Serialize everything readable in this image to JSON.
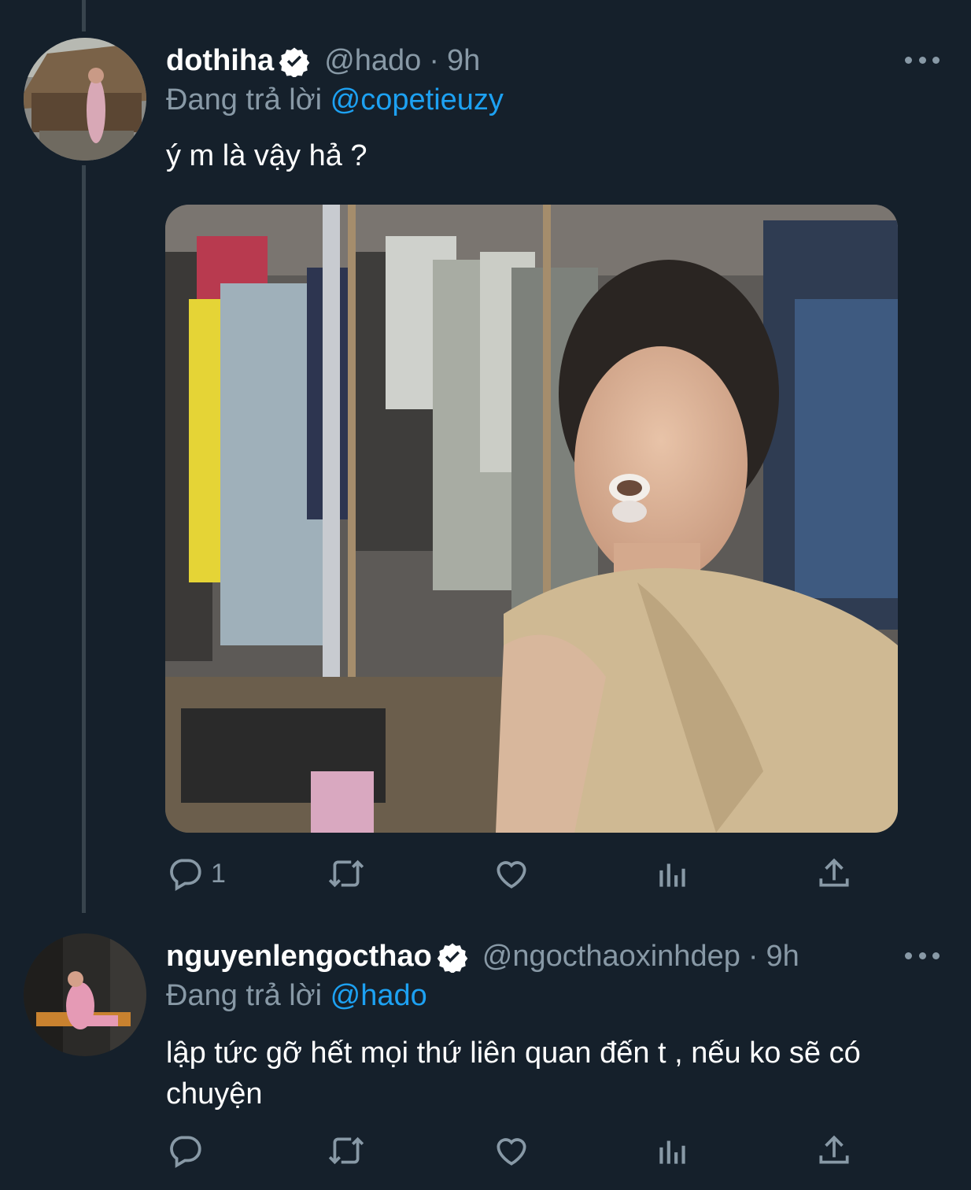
{
  "tweets": [
    {
      "display_name": "dothiha",
      "handle": "@hado",
      "separator": "·",
      "time": "9h",
      "replying_prefix": "Đang trả lời",
      "replying_to": "@copetieuzy",
      "text": "ý m là vậy hả ?",
      "reply_count": "1",
      "verified": true
    },
    {
      "display_name": "nguyenlengocthao",
      "handle": "@ngocthaoxinhdep",
      "separator": "·",
      "time": "9h",
      "replying_prefix": "Đang trả lời",
      "replying_to": "@hado",
      "text": "lập tức gỡ hết mọi thứ liên quan đến t , nếu ko sẽ có chuyện",
      "reply_count": "",
      "verified": true
    }
  ],
  "colors": {
    "background": "#15202b",
    "secondary_text": "#8899a6",
    "link": "#1da1f2",
    "thread_line": "#38444d"
  },
  "icons": [
    "reply-icon",
    "retweet-icon",
    "like-icon",
    "analytics-icon",
    "share-icon",
    "more-icon",
    "verified-badge-icon"
  ]
}
